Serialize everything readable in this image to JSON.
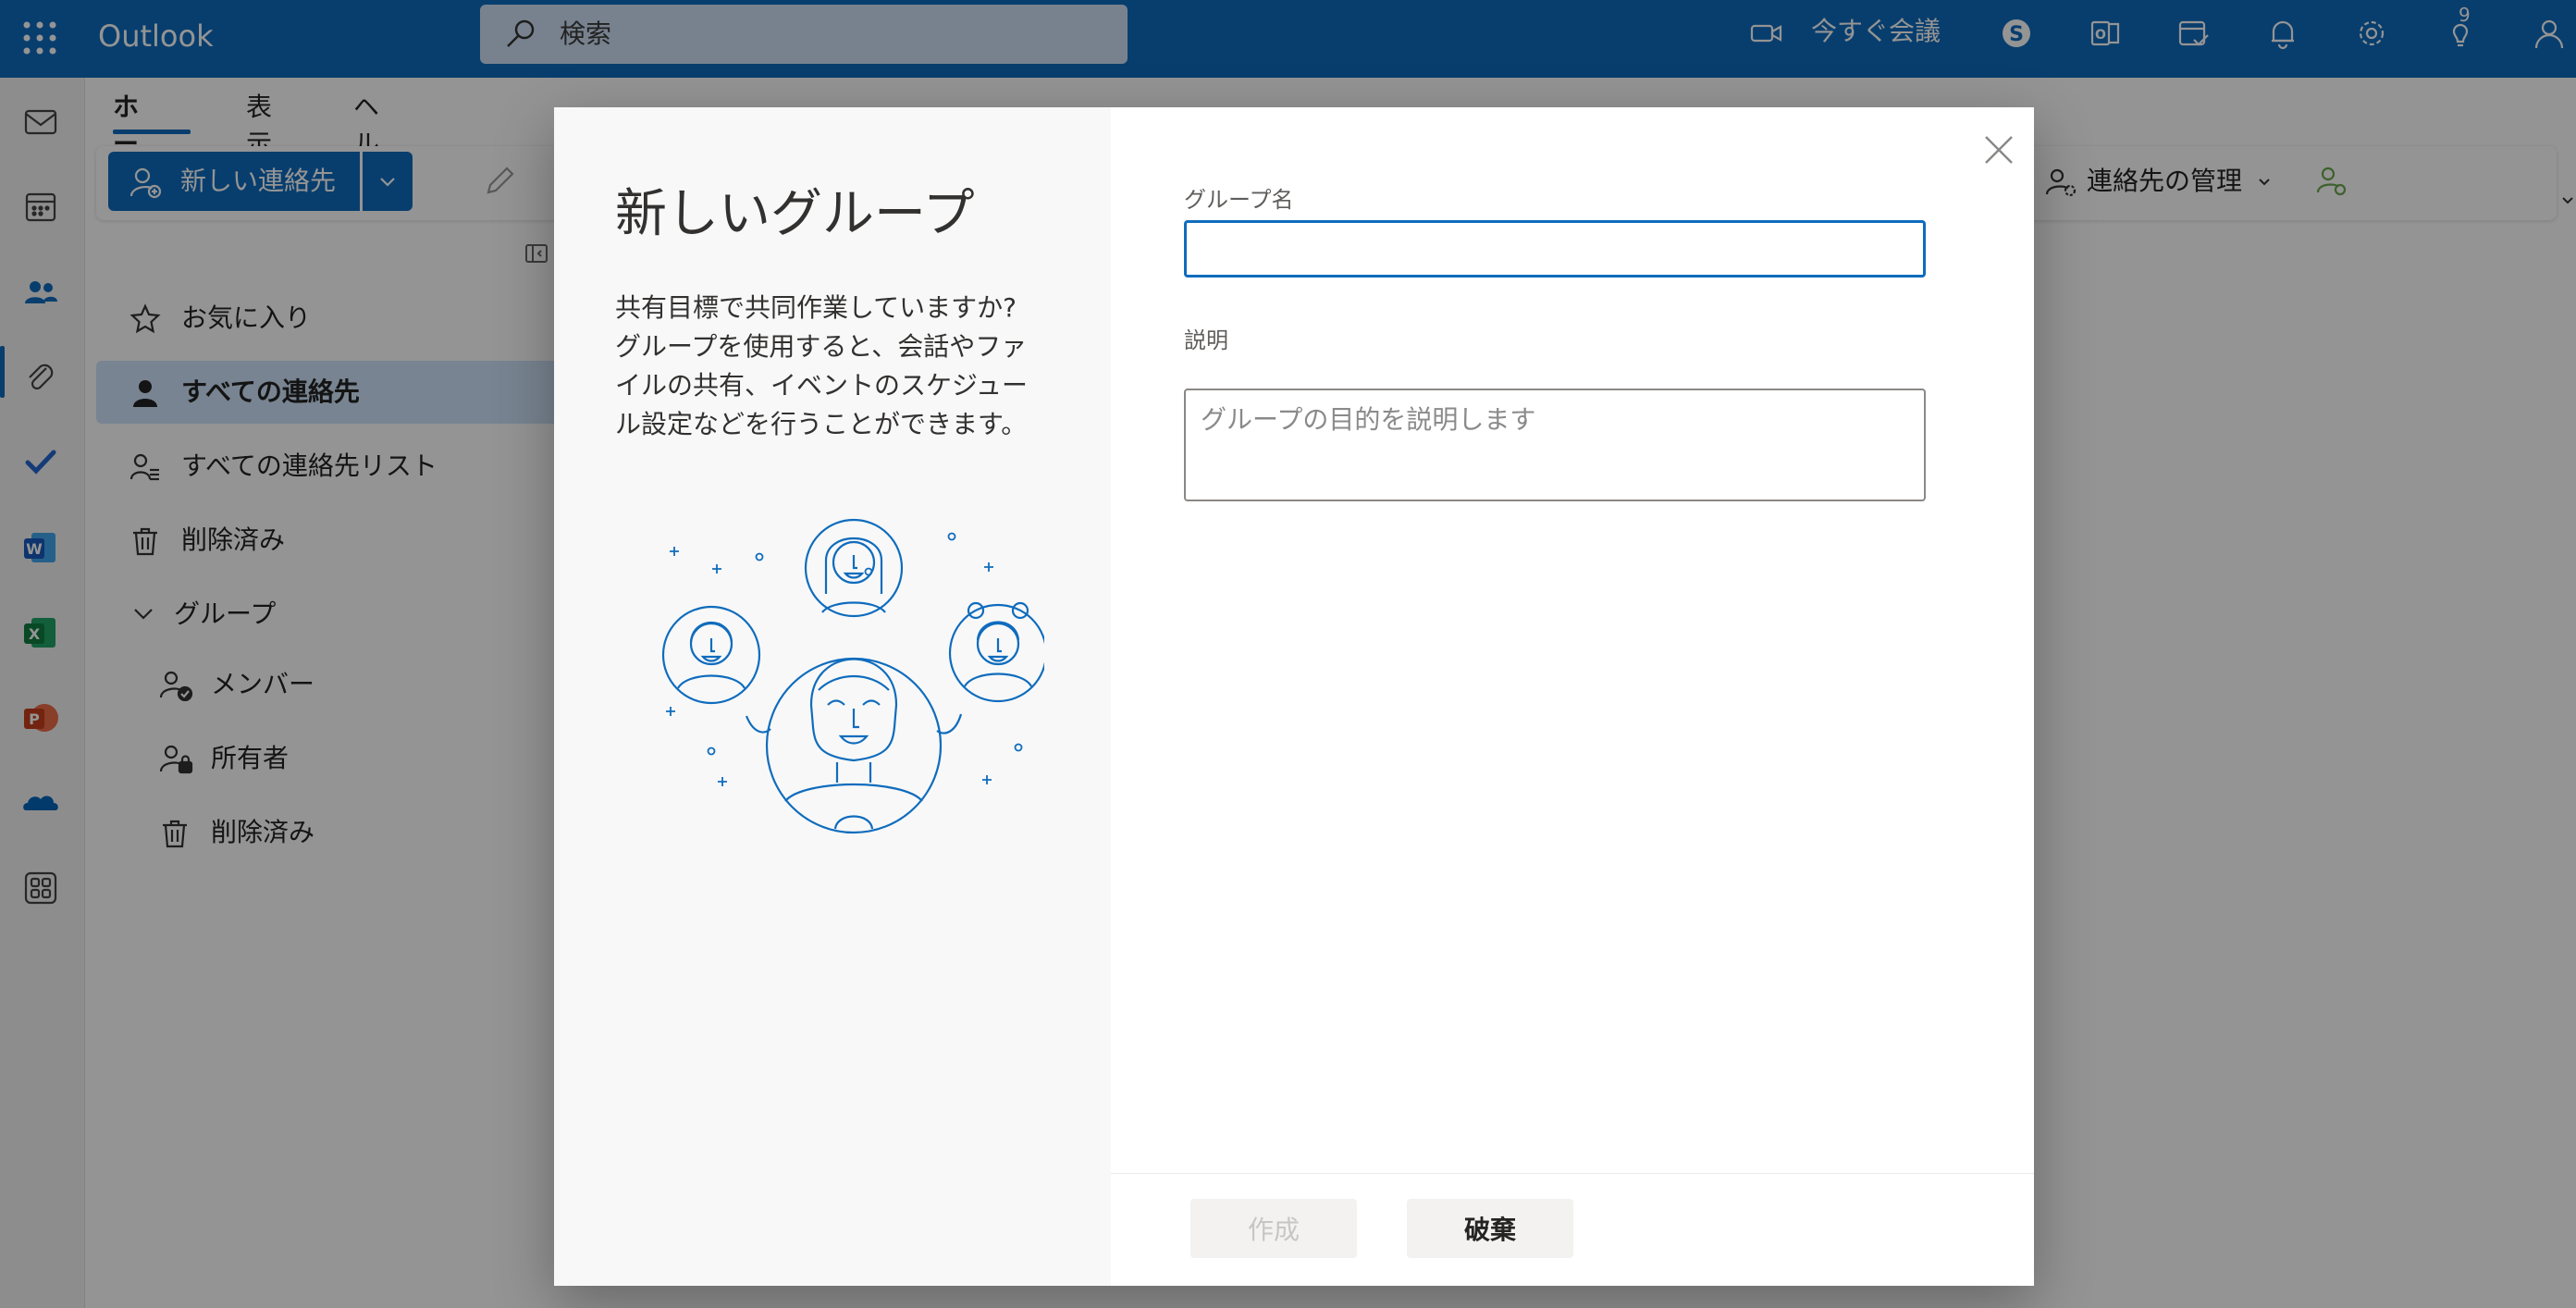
{
  "app": {
    "name": "Outlook"
  },
  "search": {
    "placeholder": "検索"
  },
  "header": {
    "meet_now_label": "今すぐ会議",
    "tips_badge": "9"
  },
  "ribbon": {
    "tabs": [
      "ホーム",
      "表示",
      "ヘルプ"
    ],
    "new_contact_label": "新しい連絡先",
    "manage_contacts_label": "連絡先の管理"
  },
  "nav": {
    "favorites": "お気に入り",
    "all_contacts": "すべての連絡先",
    "all_contact_lists": "すべての連絡先リスト",
    "deleted": "削除済み",
    "groups": "グループ",
    "members": "メンバー",
    "owners": "所有者",
    "groups_deleted": "削除済み"
  },
  "modal": {
    "title": "新しいグループ",
    "description": "共有目標で共同作業していますか? グループを使用すると、会話やファイルの共有、イベントのスケジュール設定などを行うことができます。",
    "group_name_label": "グループ名",
    "group_name_value": "",
    "description_label": "説明",
    "description_placeholder": "グループの目的を説明します",
    "create_button": "作成",
    "discard_button": "破棄"
  },
  "colors": {
    "brand": "#0f6cbd",
    "selected_nav": "#cfe4fa"
  }
}
